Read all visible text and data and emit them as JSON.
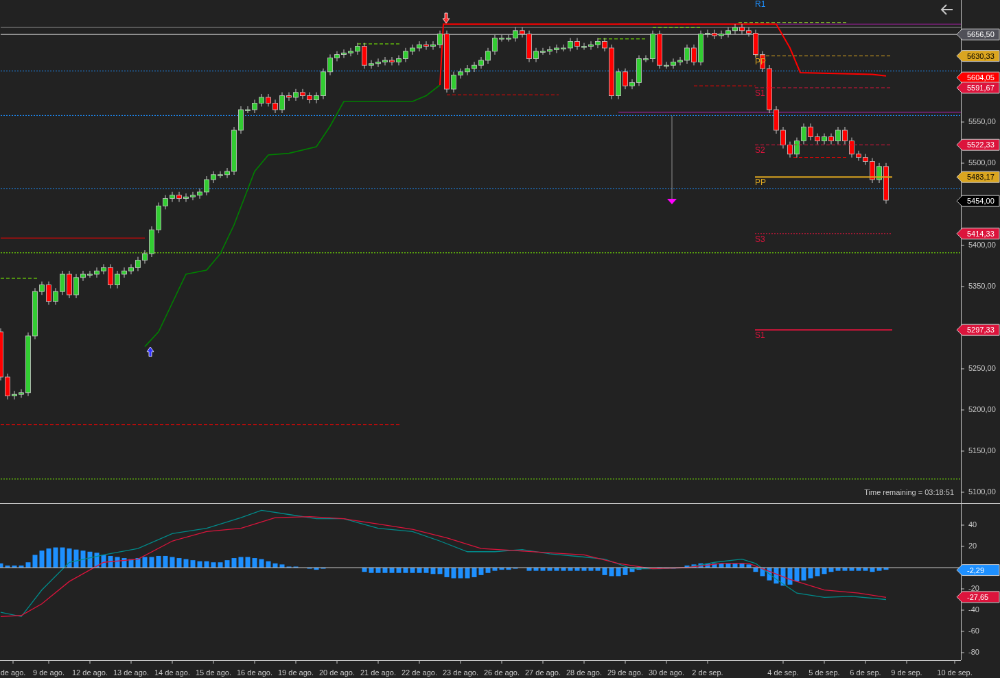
{
  "price_chart": {
    "axis_labels": [
      "5550,00",
      "5500,00",
      "5400,00",
      "5350,00",
      "5250,00",
      "5200,00",
      "5150,00",
      "5100,00"
    ],
    "pivot_labels": [
      {
        "text": "R1",
        "color": "#1e90ff"
      },
      {
        "text": "PP",
        "color": "#daa520"
      },
      {
        "text": "S1",
        "color": "#dc143c"
      },
      {
        "text": "S2",
        "color": "#dc143c"
      },
      {
        "text": "PP",
        "color": "#daa520"
      },
      {
        "text": "S3",
        "color": "#dc143c"
      },
      {
        "text": "S1",
        "color": "#dc143c"
      }
    ],
    "price_tags": [
      {
        "text": "5656,50",
        "color": "#505058"
      },
      {
        "text": "5630,33",
        "color": "#daa520"
      },
      {
        "text": "5604,05",
        "color": "#ff0000"
      },
      {
        "text": "5591,67",
        "color": "#dc143c"
      },
      {
        "text": "5522,33",
        "color": "#dc143c"
      },
      {
        "text": "5483,17",
        "color": "#daa520"
      },
      {
        "text": "5454,00",
        "color": "#000000"
      },
      {
        "text": "5414,33",
        "color": "#dc143c"
      },
      {
        "text": "5297,33",
        "color": "#dc143c"
      }
    ],
    "time_remaining": "Time remaining = 03:18:51"
  },
  "macd_chart": {
    "axis_labels": [
      "40",
      "20",
      "-20",
      "-40",
      "-60",
      "-80"
    ],
    "value_tags": [
      {
        "text": "-2,29",
        "color": "#1e90ff"
      },
      {
        "text": "-27,65",
        "color": "#dc143c"
      }
    ]
  },
  "date_axis": {
    "labels": [
      "de ago.",
      "9 de ago.",
      "12 de ago.",
      "13 de ago.",
      "14 de ago.",
      "15 de ago.",
      "16 de ago.",
      "19 de ago.",
      "20 de ago.",
      "21 de ago.",
      "22 de ago.",
      "23 de ago.",
      "26 de ago.",
      "27 de ago.",
      "28 de ago.",
      "29 de ago.",
      "30 de ago.",
      "2 de sep.",
      "4 de sep.",
      "5 de sep.",
      "6 de sep.",
      "9 de sep.",
      "10 de sep."
    ]
  }
}
